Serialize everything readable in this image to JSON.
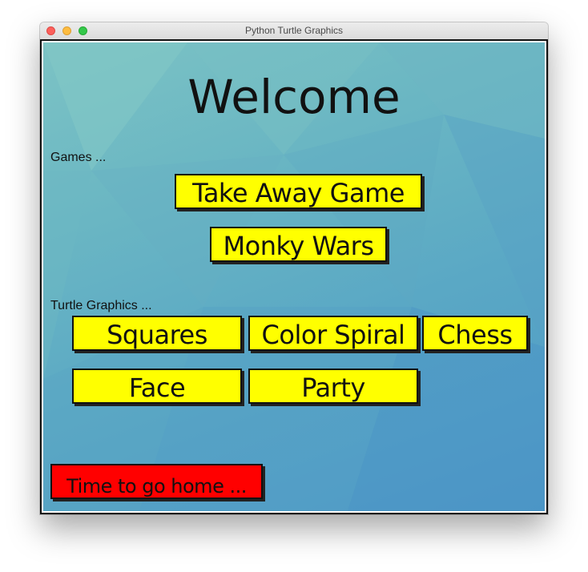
{
  "window": {
    "title": "Python Turtle Graphics"
  },
  "screen": {
    "heading": "Welcome",
    "games_label": "Games ...",
    "graphics_label": "Turtle Graphics ..."
  },
  "games": [
    {
      "label": "Take Away Game"
    },
    {
      "label": "Monky Wars"
    }
  ],
  "graphics": [
    {
      "label": "Squares"
    },
    {
      "label": "Color Spiral"
    },
    {
      "label": "Chess"
    },
    {
      "label": "Face"
    },
    {
      "label": "Party"
    }
  ],
  "home_button": {
    "label": "Time to go home ..."
  },
  "colors": {
    "button_fill": "#ffff00",
    "home_fill": "#ff0000",
    "background": "#5fb0c4"
  }
}
